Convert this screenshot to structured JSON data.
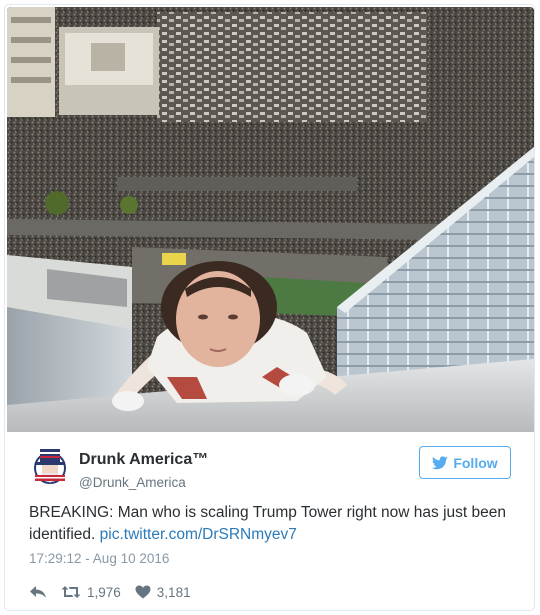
{
  "tweet": {
    "author": {
      "display_name": "Drunk America™",
      "handle": "@Drunk_America",
      "avatar_icon": "uncle-sam-logo"
    },
    "follow_button": {
      "label": "Follow",
      "icon": "twitter-bird-icon",
      "color": "#55acee"
    },
    "text": {
      "body": "BREAKING: Man who is scaling Trump Tower right now has just been identified. ",
      "link": "pic.twitter.com/DrSRNmyev7",
      "link_color": "#2b7bb9"
    },
    "timestamp": "17:29:12 - Aug 10 2016",
    "actions": {
      "reply_icon": "reply-icon",
      "retweet_icon": "retweet-icon",
      "retweet_count": "1,976",
      "like_icon": "heart-icon",
      "like_count": "3,181"
    },
    "media": {
      "type": "photo"
    }
  }
}
